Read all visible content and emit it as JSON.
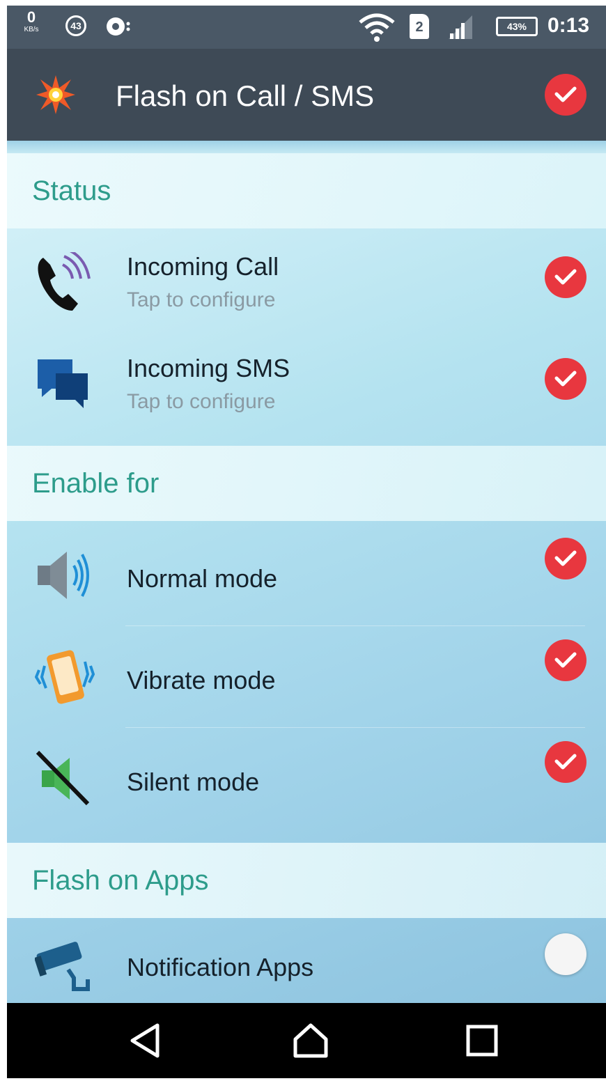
{
  "status_bar": {
    "net_speed": "0",
    "net_unit": "KB/s",
    "badge": "43",
    "sim": "2",
    "battery": "43%",
    "time": "0:13"
  },
  "app_bar": {
    "title": "Flash on Call / SMS",
    "enabled": true
  },
  "sections": [
    {
      "header": "Status",
      "rows": [
        {
          "title": "Incoming Call",
          "subtitle": "Tap to configure",
          "icon": "phone-call-icon",
          "checked": true
        },
        {
          "title": "Incoming SMS",
          "subtitle": "Tap to configure",
          "icon": "chat-bubbles-icon",
          "checked": true
        }
      ]
    },
    {
      "header": "Enable for",
      "rows": [
        {
          "title": "Normal mode",
          "icon": "speaker-icon",
          "checked": true
        },
        {
          "title": "Vibrate mode",
          "icon": "vibrate-phone-icon",
          "checked": true
        },
        {
          "title": "Silent mode",
          "icon": "speaker-muted-icon",
          "checked": true
        }
      ]
    },
    {
      "header": "Flash on Apps",
      "rows": [
        {
          "title": "Notification Apps",
          "icon": "security-camera-icon",
          "checked": false
        }
      ]
    }
  ],
  "nav": [
    "back",
    "home",
    "recents"
  ],
  "colors": {
    "check_red": "#e8373f",
    "header_green": "#2d9c8b",
    "app_bar": "#3e4a56"
  }
}
